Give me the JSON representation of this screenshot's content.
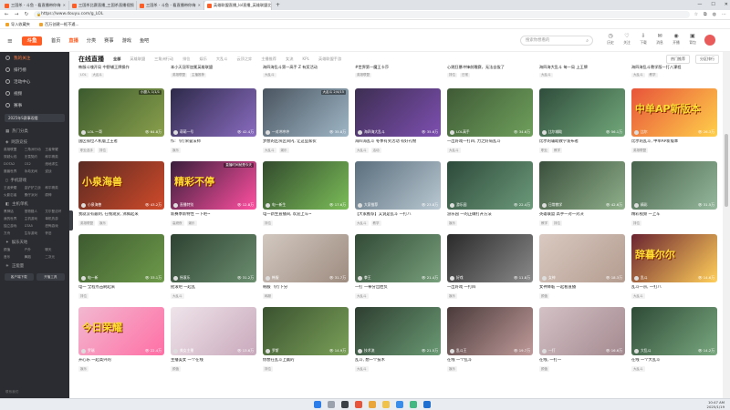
{
  "browser": {
    "tabs": [
      {
        "label": "三国杀 - 斗鱼 - 看直播带你嗨",
        "active": false
      },
      {
        "label": "三国杀比赛直播_三国杀直播视频",
        "active": false
      },
      {
        "label": "三国杀 - 斗鱼 - 看直播带你嗨",
        "active": false
      },
      {
        "label": "英雄联盟直播_lol直播_英雄联盟比",
        "active": true
      }
    ],
    "url": "https://www.douyu.com/g_LOL",
    "bookmarks": [
      "导入收藏夹",
      "百万创建一框不通..."
    ]
  },
  "site": {
    "logo_text": "斗鱼",
    "nav": [
      "首页",
      "直播",
      "分类",
      "赛事",
      "游戏",
      "鱼吧"
    ],
    "nav_selected": "直播",
    "search_placeholder": "搜索你想看的",
    "tool_icons": [
      {
        "icon": "history-icon",
        "label": "历史"
      },
      {
        "icon": "follow-icon",
        "label": "关注"
      },
      {
        "icon": "download-icon",
        "label": "下载"
      },
      {
        "icon": "mail-icon",
        "label": "消息"
      },
      {
        "icon": "start-live-icon",
        "label": "开播"
      },
      {
        "icon": "bag-icon",
        "label": "背包"
      }
    ]
  },
  "sidebar": {
    "items": [
      {
        "label": "我的关注",
        "active": true
      },
      {
        "label": "排行榜",
        "active": false
      },
      {
        "label": "活动中心",
        "active": false
      },
      {
        "label": "视频",
        "active": false
      },
      {
        "label": "赛事",
        "active": false
      }
    ],
    "promo": "2025年S赛事观看",
    "sections": [
      {
        "title": "热门分类",
        "items": []
      },
      {
        "title": "网游竞技",
        "items": [
          "英雄联盟",
          "三角洲行动",
          "王者荣耀",
          "穿越火线",
          "无畏契约",
          "和平精英",
          "DOTA2",
          "CS2",
          "绝地求生",
          "魔兽世界",
          "永劫无间",
          "逆战"
        ]
      },
      {
        "title": "手机游戏",
        "items": [
          "王者荣耀",
          "金铲铲之战",
          "和平精英",
          "火影忍者",
          "蛋仔派对",
          "原神"
        ]
      },
      {
        "title": "主机单机",
        "items": [
          "黑神话",
          "怪物猎人",
          "艾尔登法环",
          "我的世界",
          "主机游戏",
          "单机热游",
          "独立游戏",
          "GTA5",
          "恐怖游戏",
          "方舟",
          "生存游戏",
          "怀旧"
        ]
      },
      {
        "title": "娱乐天地",
        "items": [
          "颜值",
          "户外",
          "聊天",
          "音乐",
          "舞蹈",
          "二次元"
        ]
      },
      {
        "title": "正能量",
        "items": []
      }
    ],
    "promo_row": [
      "客户端下载",
      "开播工具"
    ],
    "footer": "联系我们"
  },
  "main": {
    "title": "在线直播",
    "filters": [
      "全部",
      "英雄联盟",
      "三角洲行动",
      "排位",
      "娱乐",
      "大乱斗",
      "云顶之弈",
      "主播推荐",
      "女流",
      "KPL",
      "英雄联盟手游"
    ],
    "filter_selected": "全部",
    "tools": [
      "热门推荐",
      "分区排行"
    ],
    "partial_row": [
      {
        "title": "韩服斗魂开局 中野辅王牌操作",
        "tags": [
          "LOL",
          "大乱斗"
        ]
      },
      {
        "title": "本小天冠军加冕英雄联盟",
        "tags": [
          "英雄联盟",
          "主播推荐"
        ]
      },
      {
        "title": "海四海乱斗第一高手 Z 有奖活动",
        "tags": [
          "大乱斗"
        ]
      },
      {
        "title": "#世界第一魔王卡莎",
        "tags": [
          "英雄联盟"
        ]
      },
      {
        "title": "心跳狂暴冲锋前瞻赛，无法自拔了",
        "tags": [
          "排位",
          "日常"
        ]
      },
      {
        "title": "海四海大乱斗 每一局 上王牌",
        "tags": [
          "大乱斗"
        ]
      },
      {
        "title": "海四海乱斗教学版一打八课程",
        "tags": [
          "大乱斗",
          "教学"
        ]
      },
      {
        "title": "朱光炫战的现场",
        "tags": [
          "英雄联盟"
        ]
      }
    ],
    "cards": [
      {
        "title": "国区排位人机版上王者",
        "streamer": "LOL 一哥",
        "views": "64.8万",
        "badge": "小魔人 1/1/1",
        "tags": [
          "职业选手",
          "排位"
        ],
        "bg": "#3b5a2e",
        "accent": "#8aa04c",
        "overlay": ""
      },
      {
        "title": "作: 飞行荣誉法师",
        "streamer": "萌萌一号",
        "views": "42.4万",
        "badge": "",
        "tags": [
          "娱乐"
        ],
        "bg": "#2e2a4a",
        "accent": "#8a6cc0",
        "overlay": ""
      },
      {
        "title": "梦想的区块区间内, 让这些家伙",
        "streamer": "一对冲冲冲",
        "views": "35.8万",
        "badge": "大乱斗 2/4/15",
        "tags": [
          "大乱斗",
          "娱乐"
        ],
        "bg": "#4a5560",
        "accent": "#9fb6c6",
        "overlay": ""
      },
      {
        "title": "海四海乱斗 冬季有奖活动 有好礼物",
        "streamer": "海四海大乱斗",
        "views": "35.6万",
        "badge": "",
        "tags": [
          "大乱斗",
          "活动"
        ],
        "bg": "#3d2e52",
        "accent": "#7d4fb0",
        "overlay": ""
      },
      {
        "title": "一出好戏一打四, 力之好局乱斗",
        "streamer": "LOL高手",
        "views": "34.6万",
        "badge": "",
        "tags": [
          "大乱斗"
        ],
        "bg": "#3f5a36",
        "accent": "#6fa05c",
        "overlay": ""
      },
      {
        "title": "比尔的辅助教学发布者",
        "streamer": "比尔辅助",
        "views": "56.1万",
        "badge": "",
        "tags": [
          "职业",
          "教学"
        ],
        "bg": "#2f4d3c",
        "accent": "#72a87a",
        "overlay": ""
      },
      {
        "title": "比尔的乱斗, 中单AP新版本",
        "streamer": "比尔",
        "views": "26.3万",
        "badge": "",
        "tags": [
          "英雄联盟"
        ],
        "bg": "#e8543a",
        "accent": "#ffd04a",
        "overlay": "中单AP新版本"
      },
      {
        "title": "联盟的电竞视频上 我也一起 上车",
        "streamer": "小宝宝",
        "views": "14.9万",
        "badge": "",
        "tags": [
          "主播推荐"
        ],
        "bg": "#f6d3d9",
        "accent": "#f0a0b0",
        "overlay": "超强推荐"
      },
      {
        "title": "我就没有最刺, 在线观赏, 沸腾起来",
        "streamer": "小泉海兽",
        "views": "43.2万",
        "badge": "",
        "tags": [
          "英雄联盟",
          "娱乐"
        ],
        "bg": "#5a2a22",
        "accent": "#d04a2a",
        "overlay": "小泉海兽"
      },
      {
        "title": "新赛季新特性 一下吧~",
        "streamer": "直播特别",
        "views": "12.8万",
        "badge": "直播时间就是今天",
        "tags": [
          "高燃夜",
          "娱乐"
        ],
        "bg": "#3a1f3c",
        "accent": "#ff4fa0",
        "overlay": "精彩不停"
      },
      {
        "title": "电一新生直播间, 欢迎上车~",
        "streamer": "电一新生",
        "views": "17.6万",
        "badge": "",
        "tags": [
          "排位"
        ],
        "bg": "#324a2d",
        "accent": "#7bbd58",
        "overlay": ""
      },
      {
        "title": "【大家推荐】又说是乱斗 一打八",
        "streamer": "大家推荐",
        "views": "23.8万",
        "badge": "",
        "tags": [
          "大乱斗",
          "教学"
        ],
        "bg": "#5a6e7c",
        "accent": "#b9c8d2",
        "overlay": ""
      },
      {
        "title": "游乐园 一的正确打开方法",
        "streamer": "游乐园",
        "views": "22.4万",
        "badge": "",
        "tags": [
          "娱乐"
        ],
        "bg": "#2d4a3a",
        "accent": "#6c9a7a",
        "overlay": ""
      },
      {
        "title": "英雄联盟 高手一对一对决",
        "streamer": "日常教学",
        "views": "42.6万",
        "badge": "",
        "tags": [
          "教学",
          "排位"
        ],
        "bg": "#3a4f3c",
        "accent": "#8fb08a",
        "overlay": ""
      },
      {
        "title": "精彩视频 一上车",
        "streamer": "精彩",
        "views": "31.5万",
        "badge": "",
        "tags": [
          "排位"
        ],
        "bg": "#47624a",
        "accent": "#95b89c",
        "overlay": ""
      },
      {
        "title": "在线, 有车吗",
        "streamer": "在线",
        "views": "10.2万",
        "badge": "",
        "tags": [
          "娱乐"
        ],
        "bg": "#d7c6bd",
        "accent": "#a88a7c",
        "overlay": ""
      },
      {
        "title": "电一 全程点击刷起来",
        "streamer": "电一新",
        "views": "33.1万",
        "badge": "",
        "tags": [
          "排位"
        ],
        "bg": "#3d5a30",
        "accent": "#6e9a4a",
        "overlay": ""
      },
      {
        "title": "摇滚吧 一起乱",
        "streamer": "摇滚乐",
        "views": "31.2万",
        "badge": "",
        "tags": [
          "大乱斗"
        ],
        "bg": "#2e4232",
        "accent": "#6b8e6f",
        "overlay": ""
      },
      {
        "title": "韩服 飞行下分",
        "streamer": "韩服",
        "views": "31.7万",
        "badge": "",
        "tags": [
          "韩服"
        ],
        "bg": "#d2c8c0",
        "accent": "#9e8c80",
        "overlay": ""
      },
      {
        "title": "一打 一拳分出胜负",
        "streamer": "拳王",
        "views": "21.4万",
        "badge": "",
        "tags": [
          "大乱斗"
        ],
        "bg": "#324a36",
        "accent": "#78a07c",
        "overlay": ""
      },
      {
        "title": "一出好戏 一打四",
        "streamer": "好戏",
        "views": "11.8万",
        "badge": "",
        "tags": [
          "娱乐"
        ],
        "bg": "#2a2a2a",
        "accent": "#8a8a8a",
        "overlay": ""
      },
      {
        "title": "女神降临 一起看直播",
        "streamer": "女神",
        "views": "18.3万",
        "badge": "",
        "tags": [
          "颜值"
        ],
        "bg": "#d9c9c0",
        "accent": "#b49c90",
        "overlay": ""
      },
      {
        "title": "乱斗一宗, 一打八",
        "streamer": "乱斗",
        "views": "14.6万",
        "badge": "",
        "tags": [
          "大乱斗"
        ],
        "bg": "#6a2430",
        "accent": "#ffcf5a",
        "overlay": "辞暮尔尔"
      },
      {
        "title": "一哥一直播",
        "streamer": "主播联盟",
        "views": "18.3万",
        "badge": "",
        "tags": [
          "主播推荐"
        ],
        "bg": "#3a3a32",
        "accent": "#a0a080",
        "overlay": ""
      },
      {
        "title": "开心乐 一起高兴的",
        "streamer": "罗瑞",
        "views": "22.4万",
        "badge": "",
        "tags": [
          "娱乐"
        ],
        "bg": "#f2b8d0",
        "accent": "#ff6fa5",
        "overlay": "今日荣耀"
      },
      {
        "title": "主播美女 一个在线",
        "streamer": "美女主播",
        "views": "13.6万",
        "badge": "",
        "tags": [
          "颜值"
        ],
        "bg": "#efe4ea",
        "accent": "#c9a9bc",
        "overlay": ""
      },
      {
        "title": "你想在乱斗上赢的",
        "streamer": "罗斯",
        "views": "14.9万",
        "badge": "",
        "tags": [
          "排位"
        ],
        "bg": "#3a5230",
        "accent": "#7aa058",
        "overlay": ""
      },
      {
        "title": "乱斗, 想一个技术",
        "streamer": "技术流",
        "views": "21.5万",
        "badge": "",
        "tags": [
          "大乱斗"
        ],
        "bg": "#2e3e30",
        "accent": "#6a9a74",
        "overlay": ""
      },
      {
        "title": "在线 一个乱斗",
        "streamer": "乱斗王",
        "views": "19.7万",
        "badge": "",
        "tags": [
          "娱乐"
        ],
        "bg": "#4a3a3a",
        "accent": "#c09a9a",
        "overlay": ""
      },
      {
        "title": "在线, 一打一",
        "streamer": "一打",
        "views": "16.6万",
        "badge": "",
        "tags": [
          "颜值"
        ],
        "bg": "#d3c1c5",
        "accent": "#a48a90",
        "overlay": ""
      },
      {
        "title": "在线 一个大乱斗",
        "streamer": "大乱斗",
        "views": "14.2万",
        "badge": "",
        "tags": [
          "大乱斗"
        ],
        "bg": "#2e4a36",
        "accent": "#79a87f",
        "overlay": ""
      },
      {
        "title": "阿勃 加油一大乱斗",
        "streamer": "主播联盟",
        "views": "12.9万",
        "badge": "",
        "tags": [
          "大乱斗"
        ],
        "bg": "#4a5a3a",
        "accent": "#9ab07a",
        "overlay": ""
      }
    ]
  },
  "taskbar": {
    "start_label": "搜索",
    "time": "10:47 AM",
    "date": "2025/1/19"
  }
}
